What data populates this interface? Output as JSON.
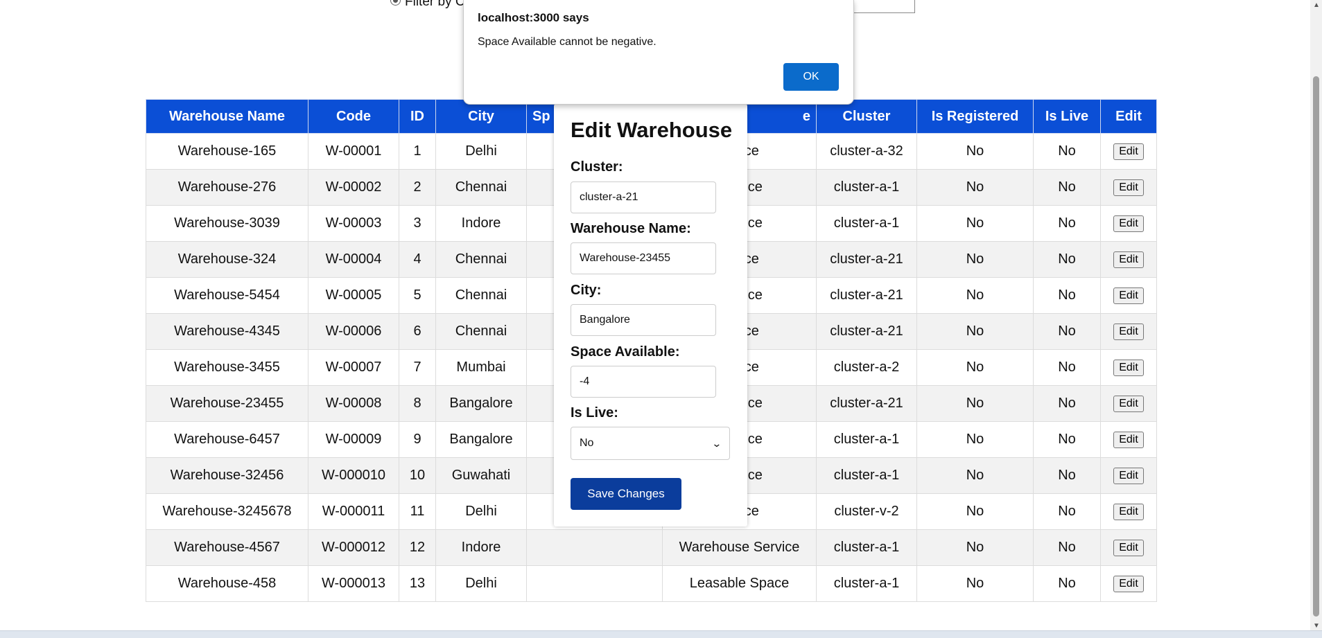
{
  "filter": {
    "label": "Filter by C"
  },
  "table": {
    "headers": [
      "Warehouse Name",
      "Code",
      "ID",
      "City",
      "Sp",
      "e",
      "Cluster",
      "Is Registered",
      "Is Live",
      "Edit"
    ],
    "rows": [
      {
        "name": "Warehouse-165",
        "code": "W-00001",
        "id": "1",
        "city": "Delhi",
        "space": "",
        "type": "Space",
        "cluster": "cluster-a-32",
        "registered": "No",
        "live": "No",
        "edit": "Edit"
      },
      {
        "name": "Warehouse-276",
        "code": "W-00002",
        "id": "2",
        "city": "Chennai",
        "space": "",
        "type": "Service",
        "cluster": "cluster-a-1",
        "registered": "No",
        "live": "No",
        "edit": "Edit"
      },
      {
        "name": "Warehouse-3039",
        "code": "W-00003",
        "id": "3",
        "city": "Indore",
        "space": "",
        "type": "Service",
        "cluster": "cluster-a-1",
        "registered": "No",
        "live": "No",
        "edit": "Edit"
      },
      {
        "name": "Warehouse-324",
        "code": "W-00004",
        "id": "4",
        "city": "Chennai",
        "space": "",
        "type": "Space",
        "cluster": "cluster-a-21",
        "registered": "No",
        "live": "No",
        "edit": "Edit"
      },
      {
        "name": "Warehouse-5454",
        "code": "W-00005",
        "id": "5",
        "city": "Chennai",
        "space": "",
        "type": "Service",
        "cluster": "cluster-a-21",
        "registered": "No",
        "live": "No",
        "edit": "Edit"
      },
      {
        "name": "Warehouse-4345",
        "code": "W-00006",
        "id": "6",
        "city": "Chennai",
        "space": "",
        "type": "Space",
        "cluster": "cluster-a-21",
        "registered": "No",
        "live": "No",
        "edit": "Edit"
      },
      {
        "name": "Warehouse-3455",
        "code": "W-00007",
        "id": "7",
        "city": "Mumbai",
        "space": "",
        "type": "Space",
        "cluster": "cluster-a-2",
        "registered": "No",
        "live": "No",
        "edit": "Edit"
      },
      {
        "name": "Warehouse-23455",
        "code": "W-00008",
        "id": "8",
        "city": "Bangalore",
        "space": "",
        "type": "Service",
        "cluster": "cluster-a-21",
        "registered": "No",
        "live": "No",
        "edit": "Edit"
      },
      {
        "name": "Warehouse-6457",
        "code": "W-00009",
        "id": "9",
        "city": "Bangalore",
        "space": "",
        "type": "Service",
        "cluster": "cluster-a-1",
        "registered": "No",
        "live": "No",
        "edit": "Edit"
      },
      {
        "name": "Warehouse-32456",
        "code": "W-000010",
        "id": "10",
        "city": "Guwahati",
        "space": "",
        "type": "Service",
        "cluster": "cluster-a-1",
        "registered": "No",
        "live": "No",
        "edit": "Edit"
      },
      {
        "name": "Warehouse-3245678",
        "code": "W-000011",
        "id": "11",
        "city": "Delhi",
        "space": "",
        "type": "Space",
        "cluster": "cluster-v-2",
        "registered": "No",
        "live": "No",
        "edit": "Edit"
      },
      {
        "name": "Warehouse-4567",
        "code": "W-000012",
        "id": "12",
        "city": "Indore",
        "space": "",
        "type": "Warehouse Service",
        "cluster": "cluster-a-1",
        "registered": "No",
        "live": "No",
        "edit": "Edit"
      },
      {
        "name": "Warehouse-458",
        "code": "W-000013",
        "id": "13",
        "city": "Delhi",
        "space": "",
        "type": "Leasable Space",
        "cluster": "cluster-a-1",
        "registered": "No",
        "live": "No",
        "edit": "Edit"
      }
    ]
  },
  "modal": {
    "title": "Edit Warehouse",
    "cluster_label": "Cluster:",
    "cluster_value": "cluster-a-21",
    "name_label": "Warehouse Name:",
    "name_value": "Warehouse-23455",
    "city_label": "City:",
    "city_value": "Bangalore",
    "space_label": "Space Available:",
    "space_value": "-4",
    "live_label": "Is Live:",
    "live_value": "No",
    "save_label": "Save Changes"
  },
  "alert": {
    "title": "localhost:3000 says",
    "message": "Space Available cannot be negative.",
    "ok_label": "OK"
  },
  "colors": {
    "header_bg": "#0b4fd6",
    "save_button": "#0b3d9c",
    "ok_button": "#0b6bcb"
  }
}
